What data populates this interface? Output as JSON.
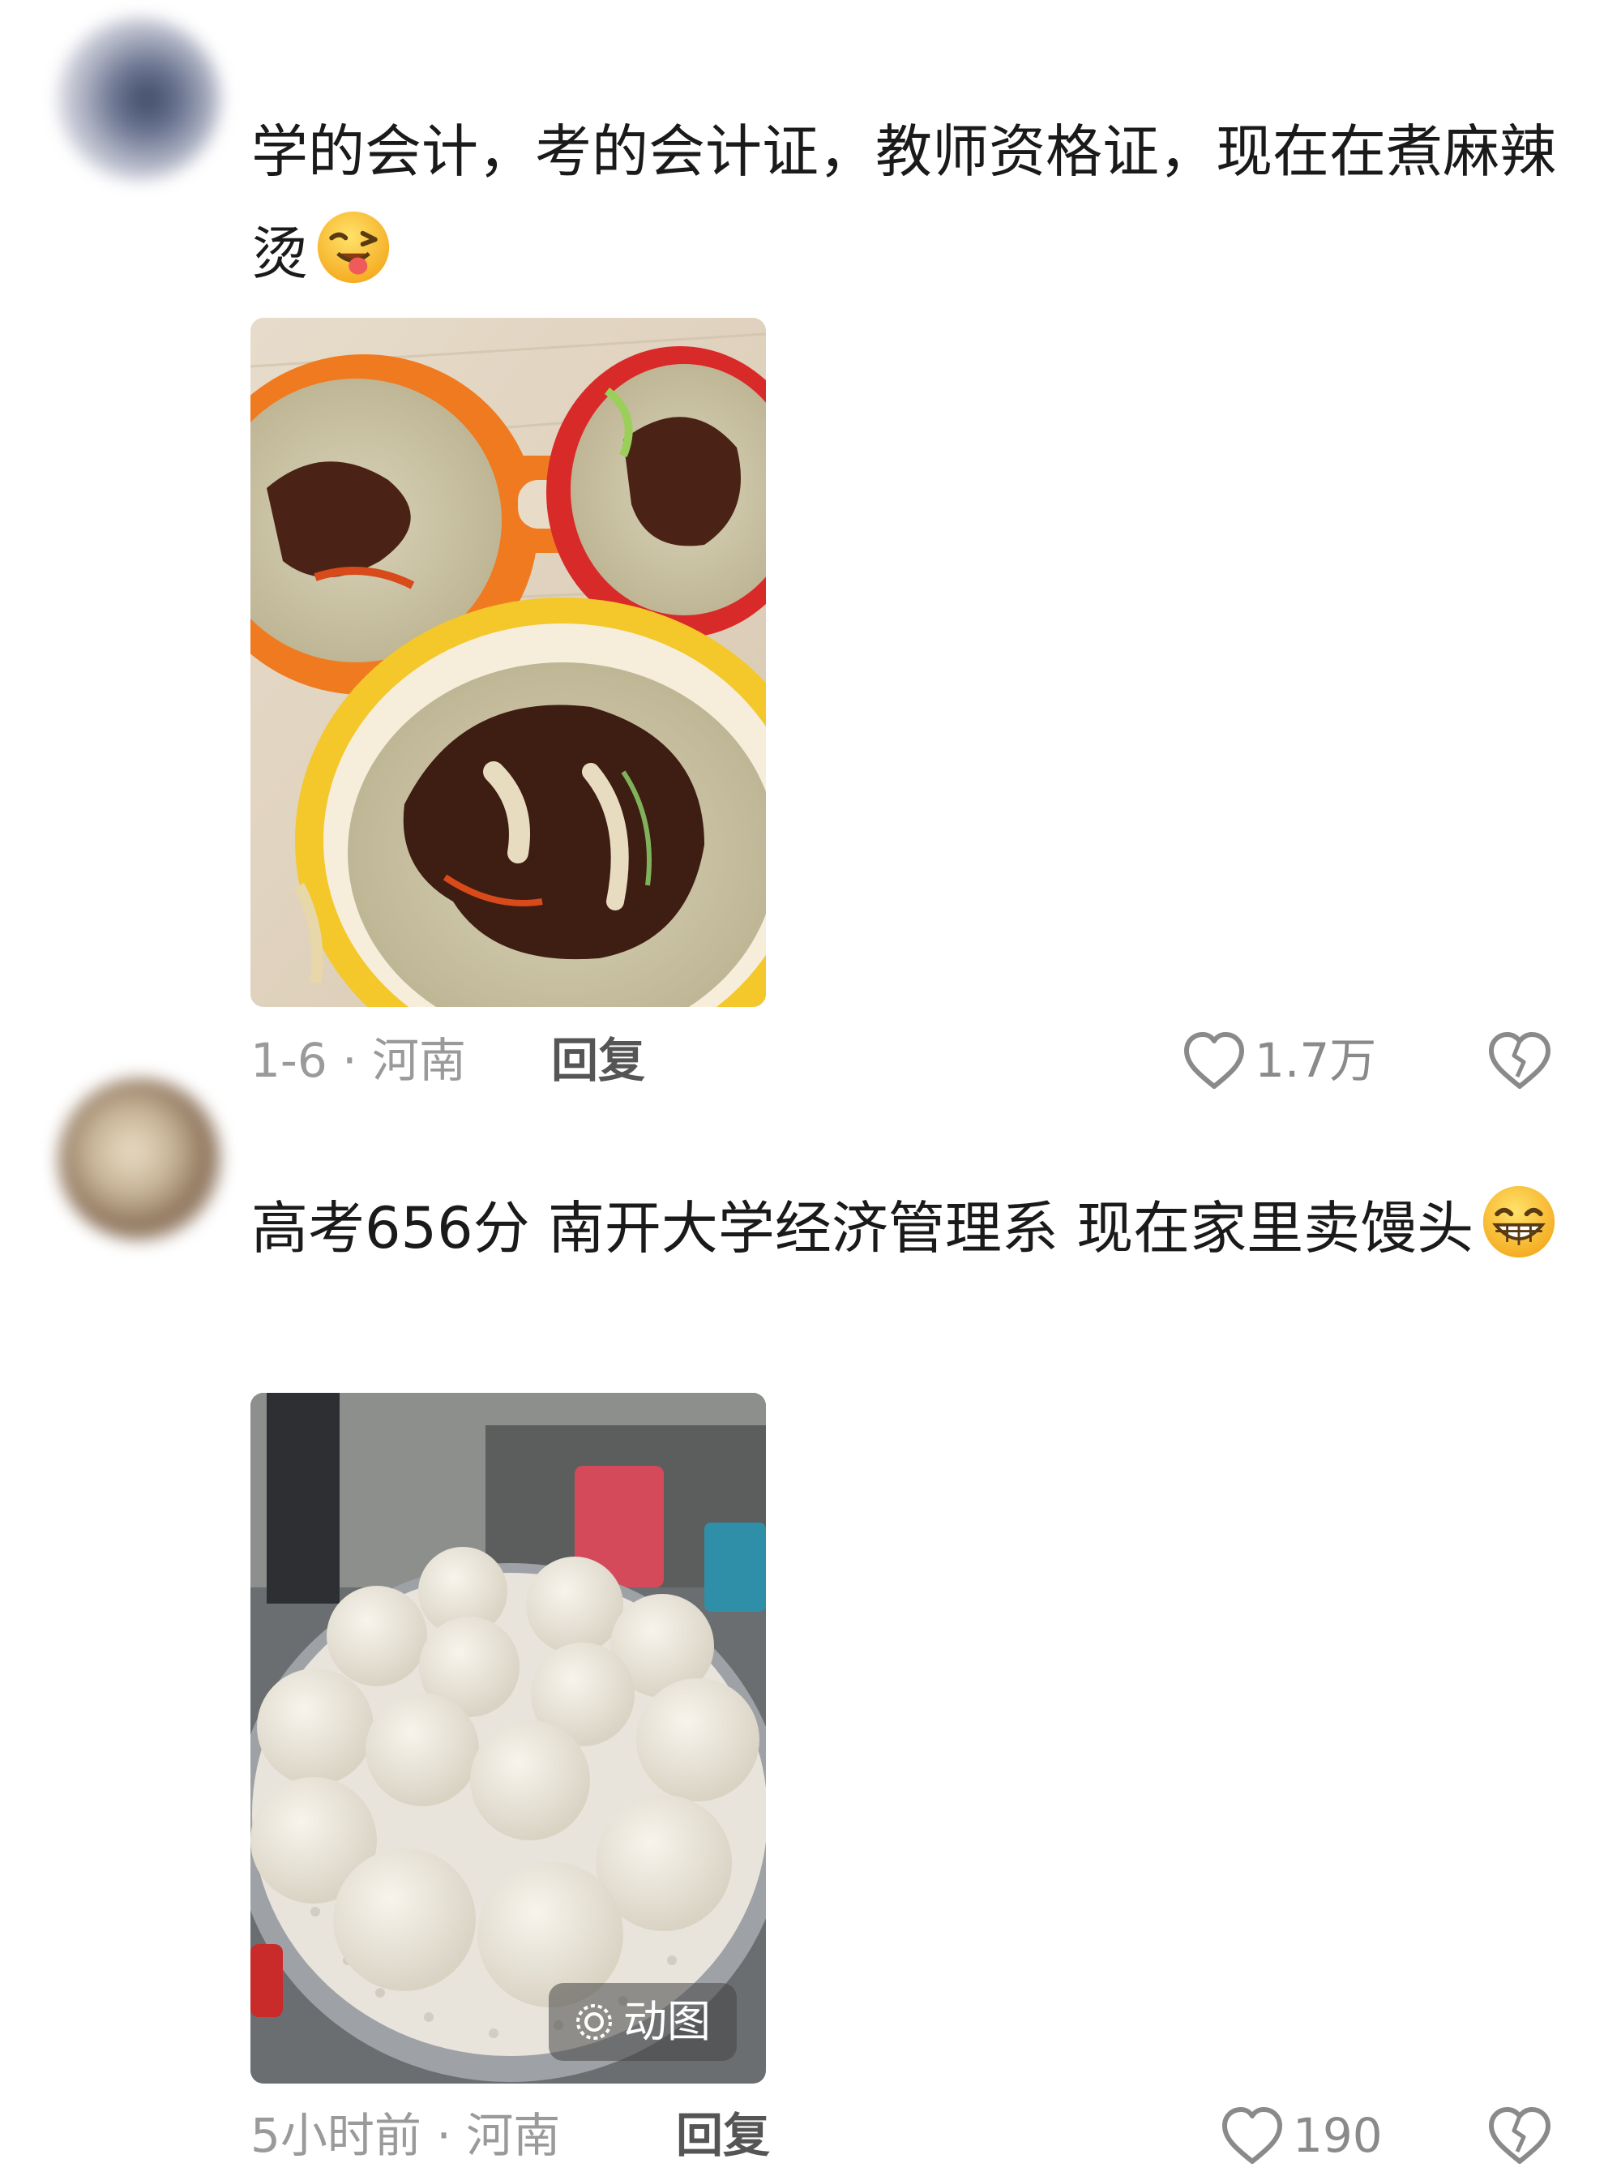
{
  "comments": [
    {
      "text": "学的会计，考的会计证，教师资格证，现在在煮麻辣烫",
      "emoji": "winking-tongue-emoji",
      "photo": "malatang-bowls-photo",
      "meta": "1-6 · 河南",
      "reply_label": "回复",
      "like_count": "1.7万"
    },
    {
      "text": "高考656分 南开大学经济管理系 现在家里卖馒头",
      "emoji": "grinning-emoji",
      "photo": "steamed-buns-photo",
      "badge": "动图",
      "meta": "5小时前 · 河南",
      "reply_label": "回复",
      "like_count": "190"
    }
  ]
}
